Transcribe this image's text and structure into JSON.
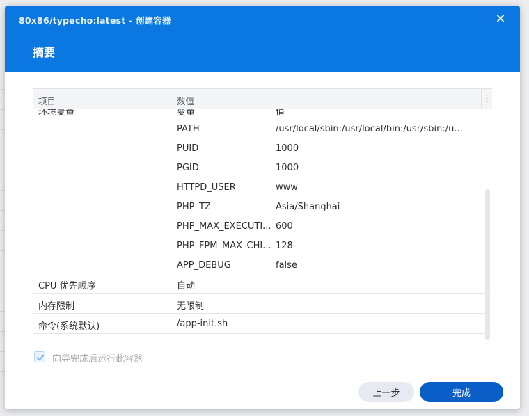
{
  "window": {
    "title": "80x86/typecho:latest - 创建容器",
    "step_title": "摘要",
    "close_icon": "close-icon"
  },
  "table": {
    "headers": {
      "item": "项目",
      "value": "数值"
    },
    "env": {
      "section_label": "环境变量",
      "col_key": "变量",
      "col_val": "值",
      "rows": [
        {
          "key": "PATH",
          "value": "/usr/local/sbin:/usr/local/bin:/usr/sbin:/u..."
        },
        {
          "key": "PUID",
          "value": "1000"
        },
        {
          "key": "PGID",
          "value": "1000"
        },
        {
          "key": "HTTPD_USER",
          "value": "www"
        },
        {
          "key": "PHP_TZ",
          "value": "Asia/Shanghai"
        },
        {
          "key": "PHP_MAX_EXECUTI...",
          "value": "600"
        },
        {
          "key": "PHP_FPM_MAX_CHI...",
          "value": "128"
        },
        {
          "key": "APP_DEBUG",
          "value": "false"
        }
      ]
    },
    "rows": [
      {
        "item": "CPU 优先顺序",
        "value": "自动"
      },
      {
        "item": "内存限制",
        "value": "无限制"
      },
      {
        "item": "命令(系统默认)",
        "value": "/app-init.sh"
      }
    ]
  },
  "checkbox": {
    "label": "向导完成后运行此容器",
    "checked": true
  },
  "buttons": {
    "prev": "上一步",
    "done": "完成"
  },
  "colors": {
    "header": "#0a78e0",
    "primary_button": "#0a5ec8"
  }
}
